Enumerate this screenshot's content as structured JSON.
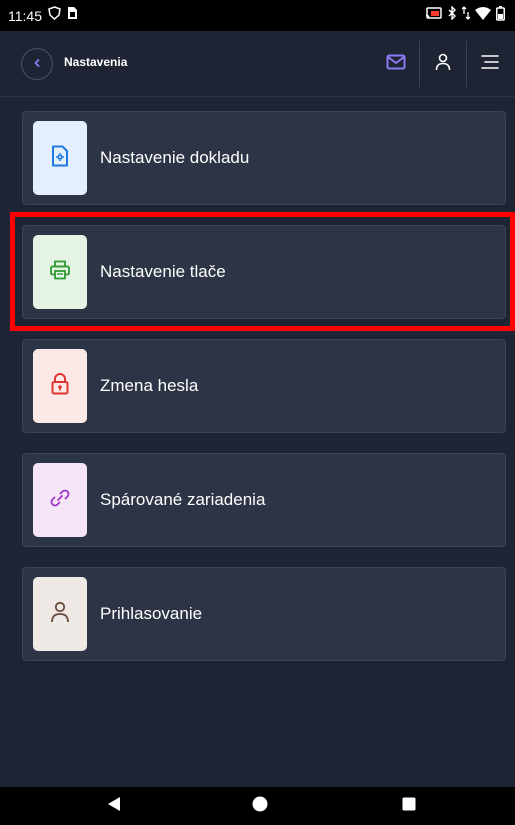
{
  "status_bar": {
    "time": "11:45",
    "icons": [
      "vpn-shield-icon",
      "sim-card-icon",
      "cast-icon",
      "bluetooth-icon",
      "data-transfer-icon",
      "wifi-icon",
      "battery-icon"
    ]
  },
  "header": {
    "title": "Nastavenia",
    "back_icon": "chevron-left-icon",
    "actions": [
      "mail-icon",
      "user-icon",
      "menu-icon"
    ],
    "accent_color": "#8b7cf6"
  },
  "menu": {
    "items": [
      {
        "label": "Nastavenie dokladu",
        "icon": "document-settings-icon",
        "icon_bg": "#e3effd",
        "icon_color": "#1f7ae0"
      },
      {
        "label": "Nastavenie tlače",
        "icon": "printer-icon",
        "icon_bg": "#e4f3e3",
        "icon_color": "#2e9b35"
      },
      {
        "label": "Zmena hesla",
        "icon": "lock-icon",
        "icon_bg": "#fde8e8",
        "icon_color": "#e0342f"
      },
      {
        "label": "Spárované zariadenia",
        "icon": "link-icon",
        "icon_bg": "#f4e6f8",
        "icon_color": "#a233c9"
      },
      {
        "label": "Prihlasovanie",
        "icon": "user-icon",
        "icon_bg": "#efe9e6",
        "icon_color": "#6b4a3c"
      }
    ],
    "highlighted_index": 1,
    "highlight_color": "#ff0000"
  },
  "nav_bar": {
    "buttons": [
      "back-triangle-icon",
      "home-circle-icon",
      "recents-square-icon"
    ]
  }
}
